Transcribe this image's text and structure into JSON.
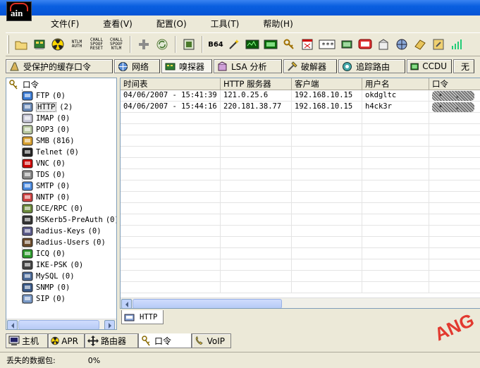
{
  "app": {
    "logo_text": "ain"
  },
  "menu": [
    "文件(F)",
    "查看(V)",
    "配置(O)",
    "工具(T)",
    "帮助(H)"
  ],
  "toolbar": {
    "ntlm_auth": "NTLM AUTH",
    "challenge_spoof_reset": "CHALL SPOOF RESET",
    "challenge_spoof_ntlm": "CHALL SPOOF NTLM",
    "b64": "B64",
    "cc": "CC"
  },
  "tabs": [
    {
      "label": "受保护的缓存口令",
      "icon": "cache-icon"
    },
    {
      "label": "网络",
      "icon": "network-icon"
    },
    {
      "label": "嗅探器",
      "icon": "sniffer-icon",
      "active": true
    },
    {
      "label": "LSA 分析",
      "icon": "lsa-icon"
    },
    {
      "label": "破解器",
      "icon": "cracker-icon"
    },
    {
      "label": "追踪路由",
      "icon": "traceroute-icon"
    },
    {
      "label": "CCDU",
      "icon": "ccdu-icon"
    },
    {
      "label": "无",
      "icon": "wireless-icon"
    }
  ],
  "tree": {
    "root": "口令",
    "items": [
      {
        "label": "FTP",
        "count": "(0)",
        "icon": "ftp-icon"
      },
      {
        "label": "HTTP",
        "count": "(2)",
        "icon": "http-icon",
        "selected": true
      },
      {
        "label": "IMAP",
        "count": "(0)",
        "icon": "imap-icon"
      },
      {
        "label": "POP3",
        "count": "(0)",
        "icon": "pop3-icon"
      },
      {
        "label": "SMB",
        "count": "(816)",
        "icon": "smb-icon"
      },
      {
        "label": "Telnet",
        "count": "(0)",
        "icon": "telnet-icon"
      },
      {
        "label": "VNC",
        "count": "(0)",
        "icon": "vnc-icon"
      },
      {
        "label": "TDS",
        "count": "(0)",
        "icon": "tds-icon"
      },
      {
        "label": "SMTP",
        "count": "(0)",
        "icon": "smtp-icon"
      },
      {
        "label": "NNTP",
        "count": "(0)",
        "icon": "nntp-icon"
      },
      {
        "label": "DCE/RPC",
        "count": "(0)",
        "icon": "dcerpc-icon"
      },
      {
        "label": "MSKerb5-PreAuth",
        "count": "(0)",
        "icon": "kerberos-icon"
      },
      {
        "label": "Radius-Keys",
        "count": "(0)",
        "icon": "radius-keys-icon"
      },
      {
        "label": "Radius-Users",
        "count": "(0)",
        "icon": "radius-users-icon"
      },
      {
        "label": "ICQ",
        "count": "(0)",
        "icon": "icq-icon"
      },
      {
        "label": "IKE-PSK",
        "count": "(0)",
        "icon": "ike-icon"
      },
      {
        "label": "MySQL",
        "count": "(0)",
        "icon": "mysql-icon"
      },
      {
        "label": "SNMP",
        "count": "(0)",
        "icon": "snmp-icon"
      },
      {
        "label": "SIP",
        "count": "(0)",
        "icon": "sip-icon"
      }
    ]
  },
  "table": {
    "columns": [
      "时间表",
      "HTTP 服务器",
      "客户端",
      "用户名",
      "口令"
    ],
    "rows": [
      [
        "04/06/2007 - 15:41:39",
        "121.0.25.6",
        "192.168.10.15",
        "okdgltc",
        ""
      ],
      [
        "04/06/2007 - 15:44:16",
        "220.181.38.77",
        "192.168.10.15",
        "h4ck3r",
        ""
      ]
    ]
  },
  "subtab": "HTTP",
  "bottom_tabs": [
    {
      "label": "主机",
      "icon": "host-icon"
    },
    {
      "label": "APR",
      "icon": "apr-icon"
    },
    {
      "label": "路由器",
      "icon": "router-icon"
    },
    {
      "label": "口令",
      "icon": "password-icon",
      "active": true
    },
    {
      "label": "VoIP",
      "icon": "voip-icon"
    }
  ],
  "status": {
    "label": "丢失的数据包:",
    "value": "0%"
  },
  "watermark": "ANG"
}
